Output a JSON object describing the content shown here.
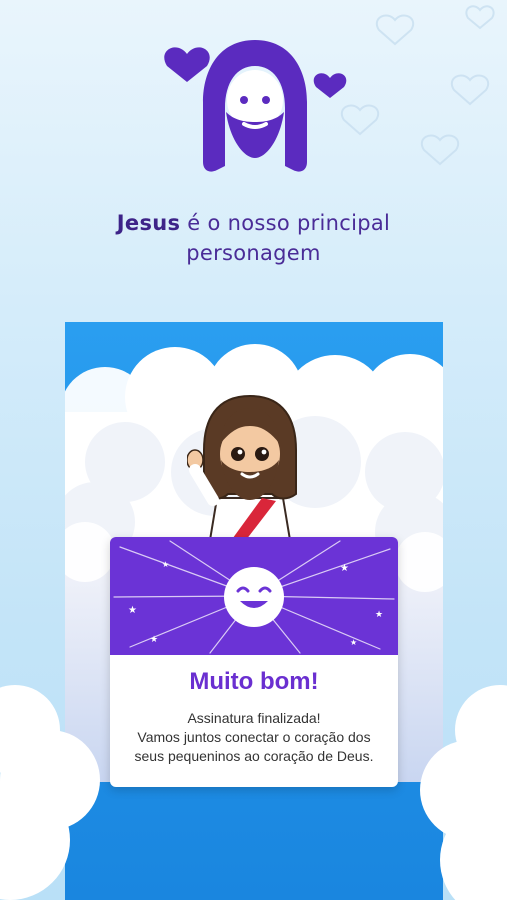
{
  "app": {
    "logo_icon": "jesus-face-with-hearts-icon",
    "brand_color": "#5b2bbf"
  },
  "intro": {
    "highlight": "Jesus",
    "line1_rest": " é o nosso principal",
    "line2": "personagem"
  },
  "success_dialog": {
    "icon": "smiling-face-icon",
    "title": "Muito bom!",
    "message_lines": [
      "Assinatura finalizada!",
      "Vamos juntos conectar o coração dos",
      "seus pequeninos ao coração de Deus."
    ],
    "title_color": "#6a2fd0",
    "header_color": "#6b33d6"
  }
}
